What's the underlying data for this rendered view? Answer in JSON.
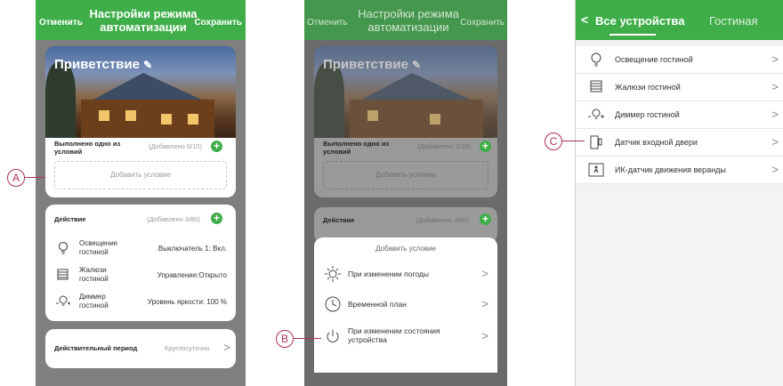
{
  "screen1": {
    "cancel": "Отменить",
    "title": "Настройки режима автоматизации",
    "save": "Сохранить",
    "scene_name": "Приветствие",
    "cond_header": "Выполнено одно из условий",
    "cond_count": "(Добавлено 0/10)",
    "add_condition": "Добавить условие",
    "action_header": "Действие",
    "action_count": "(Добавлено 3/80)",
    "actions": [
      {
        "device": "Освещение гостиной",
        "value": "Выключатель 1: Вкл.",
        "icon": "bulb-icon"
      },
      {
        "device": "Жалюзи гостиной",
        "value": "Управление:Открыто",
        "icon": "blinds-icon"
      },
      {
        "device": "Диммер гостиной",
        "value": "Уровень яркости: 100 %",
        "icon": "dimmer-icon"
      }
    ],
    "period_label": "Действительный период",
    "period_value": "Круглосуточно"
  },
  "screen2": {
    "cancel": "Отменить",
    "title": "Настройки режима автоматизации",
    "save": "Сохранить",
    "scene_name": "Приветствие",
    "cond_header": "Выполнено одно из условий",
    "cond_count": "(Добавлено 0/10)",
    "add_condition": "Добавить условие",
    "action_header": "Действие",
    "action_count": "(Добавлено 3/80)",
    "sheet_title": "Добавить условие",
    "sheet_items": [
      {
        "label": "При изменении погоды",
        "icon": "weather-icon"
      },
      {
        "label": "Временной план",
        "icon": "clock-icon"
      },
      {
        "label": "При изменении состояния устройства",
        "icon": "power-icon"
      }
    ]
  },
  "screen3": {
    "back_label": "Все устройства",
    "tab_room": "Гостиная",
    "devices": [
      {
        "label": "Освещение гостиной",
        "icon": "bulb-icon"
      },
      {
        "label": "Жалюзи гостиной",
        "icon": "blinds-icon"
      },
      {
        "label": "Диммер гостиной",
        "icon": "dimmer-icon"
      },
      {
        "label": "Датчик входной двери",
        "icon": "door-sensor-icon"
      },
      {
        "label": "ИК-датчик движения веранды",
        "icon": "motion-sensor-icon"
      }
    ]
  },
  "callouts": {
    "a": "A",
    "b": "B",
    "c": "C"
  },
  "colors": {
    "brand_green": "#3fae49",
    "callout": "#b0305a"
  }
}
